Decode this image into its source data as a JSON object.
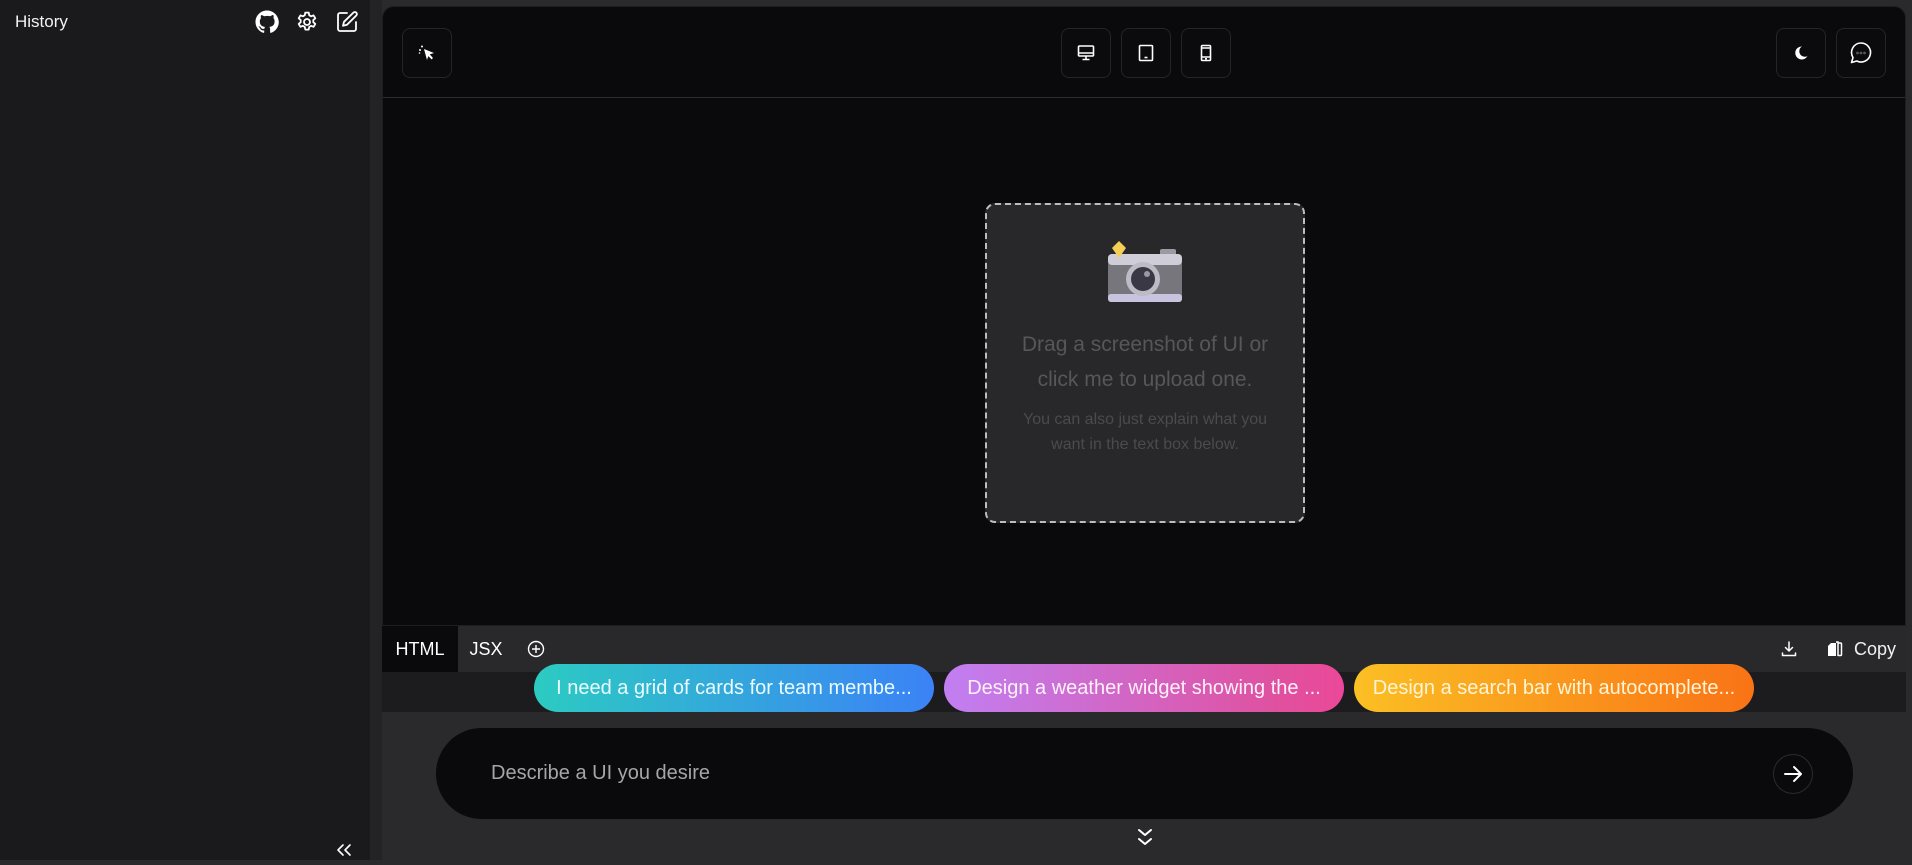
{
  "sidebar": {
    "title": "History",
    "icons": [
      "github-icon",
      "settings-icon",
      "new-edit-icon"
    ],
    "collapse_icon": "chevrons-left-icon"
  },
  "toolbar": {
    "left_button_icon": "cursor-select-icon",
    "device_buttons": [
      {
        "name": "desktop",
        "icon": "monitor-icon"
      },
      {
        "name": "tablet",
        "icon": "tablet-icon"
      },
      {
        "name": "mobile",
        "icon": "smartphone-icon"
      }
    ],
    "right_buttons": [
      {
        "name": "theme",
        "icon": "moon-icon"
      },
      {
        "name": "chat",
        "icon": "chat-bubble-icon"
      }
    ]
  },
  "dropzone": {
    "icon": "camera-with-sparkle-icon",
    "main_text": "Drag a screenshot of UI or click me to upload one.",
    "sub_text": "You can also just explain what you want in the text box below."
  },
  "code_tabs": {
    "tabs": [
      {
        "label": "HTML",
        "active": true
      },
      {
        "label": "JSX",
        "active": false
      }
    ],
    "add_icon": "plus-circle-icon",
    "download_icon": "download-icon",
    "copy_label": "Copy"
  },
  "suggestions": [
    {
      "label": "I need a grid of cards for team membe...",
      "colors": [
        "#2ccbc2",
        "#3b82f6"
      ]
    },
    {
      "label": "Design a weather widget showing the ...",
      "colors": [
        "#c17ff2",
        "#ec4899"
      ]
    },
    {
      "label": "Design a search bar with autocomplete...",
      "colors": [
        "#fbbf24",
        "#f97316"
      ]
    }
  ],
  "prompt": {
    "placeholder": "Describe a UI you desire",
    "value": "",
    "send_icon": "arrow-right-icon",
    "expand_icon": "chevrons-down-icon"
  }
}
